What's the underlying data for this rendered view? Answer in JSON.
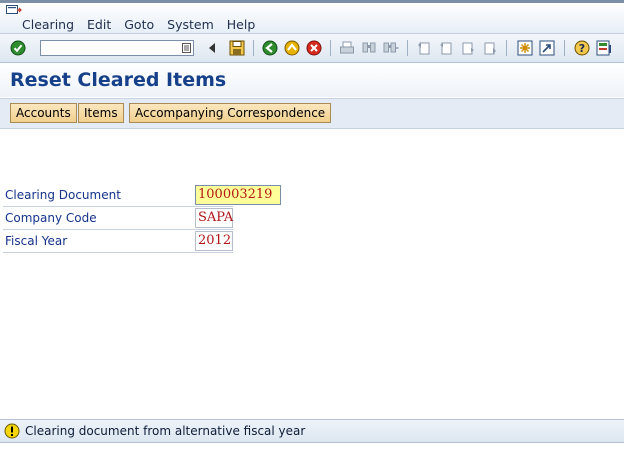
{
  "menubar": {
    "items": [
      "Clearing",
      "Edit",
      "Goto",
      "System",
      "Help"
    ]
  },
  "toolbar": {
    "command_field": {
      "value": "",
      "placeholder": ""
    },
    "icons": [
      "enter-icon",
      "command-dropdown-icon",
      "back-arrow-icon",
      "save-icon",
      "back-icon",
      "exit-icon",
      "cancel-icon",
      "print-icon",
      "find-icon",
      "find-next-icon",
      "first-page-icon",
      "previous-page-icon",
      "next-page-icon",
      "last-page-icon",
      "create-session-icon",
      "shortcut-icon",
      "help-icon",
      "layout-menu-icon"
    ]
  },
  "page": {
    "title": "Reset Cleared Items"
  },
  "application_toolbar": {
    "buttons": [
      "Accounts",
      "Items",
      "Accompanying Correspondence"
    ]
  },
  "form": {
    "clearing_document": {
      "label": "Clearing Document",
      "value": "100003219"
    },
    "company_code": {
      "label": "Company Code",
      "value": "SAPA"
    },
    "fiscal_year": {
      "label": "Fiscal Year",
      "value": "2012"
    }
  },
  "status": {
    "type": "warning",
    "message": "Clearing document from alternative fiscal year"
  },
  "colors": {
    "title": "#16408a",
    "label": "#16338c",
    "field_value": "#b01616",
    "active_field": "#ffff99",
    "button": "#f0cf8c"
  }
}
